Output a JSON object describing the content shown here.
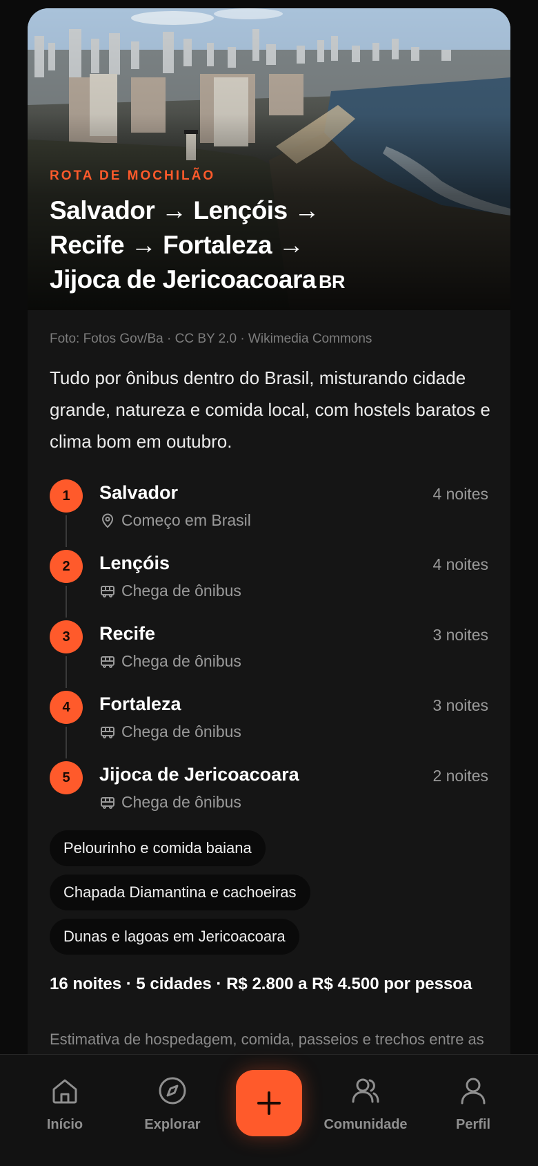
{
  "route": {
    "kicker": "ROTA DE MOCHILÃO",
    "title_line1": "Salvador → Lençóis →",
    "title_line2": "Recife → Fortaleza →",
    "title_line3": "Jijoca de Jericoacoara",
    "country_code": "BR",
    "photo_credit": "Foto: Fotos Gov/Ba · CC BY 2.0 · Wikimedia Commons",
    "description": "Tudo por ônibus dentro do Brasil, misturando cidade grande, natureza e comida local, com hostels baratos e clima bom em outubro."
  },
  "stops": [
    {
      "number": "1",
      "name": "Salvador",
      "nights": "4 noites",
      "detail": "Começo em Brasil",
      "icon": "location-pin-icon"
    },
    {
      "number": "2",
      "name": "Lençóis",
      "nights": "4 noites",
      "detail": "Chega de ônibus",
      "icon": "bus-icon"
    },
    {
      "number": "3",
      "name": "Recife",
      "nights": "3 noites",
      "detail": "Chega de ônibus",
      "icon": "bus-icon"
    },
    {
      "number": "4",
      "name": "Fortaleza",
      "nights": "3 noites",
      "detail": "Chega de ônibus",
      "icon": "bus-icon"
    },
    {
      "number": "5",
      "name": "Jijoca de Jericoacoara",
      "nights": "2 noites",
      "detail": "Chega de ônibus",
      "icon": "bus-icon"
    }
  ],
  "highlights": [
    "Pelourinho e comida baiana",
    "Chapada Diamantina e cachoeiras",
    "Dunas e lagoas em Jericoacoara"
  ],
  "summary": "16 noites · 5 cidades · R$ 2.800 a R$ 4.500 por pessoa",
  "estimate_note": "Estimativa de hospedagem, comida, passeios e trechos entre as cidades, sem o transporte até a primeira",
  "nav": {
    "home": "Início",
    "explore": "Explorar",
    "add": "+",
    "community": "Comunidade",
    "profile": "Perfil"
  },
  "colors": {
    "accent": "#ff5a2b",
    "background": "#0b0b0b",
    "card": "#151515"
  }
}
